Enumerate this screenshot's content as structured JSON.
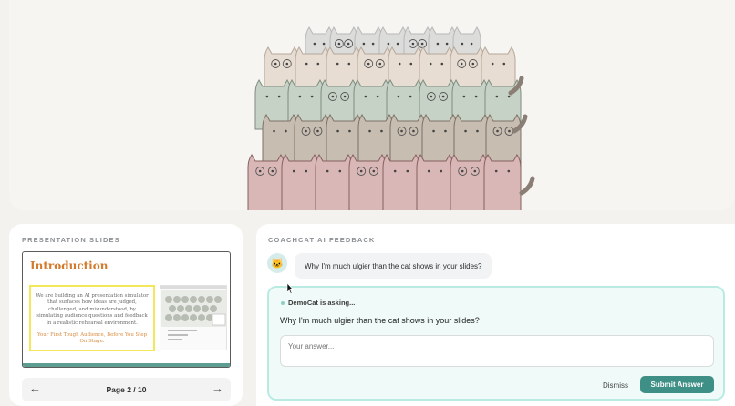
{
  "slides_panel": {
    "label": "PRESENTATION SLIDES",
    "slide": {
      "title": "Introduction",
      "body": "We are building an AI presentation simulator that surfaces how ideas are judged, challenged, and misunderstood, by simulating audience questions and feedback in a realistic rehearsal environment.",
      "tagline": "Your First Tough Audience, Before You Step On Stage."
    },
    "pager": {
      "prev": "←",
      "page_text": "Page 2 / 10",
      "next": "→"
    }
  },
  "feedback_panel": {
    "label": "COACHCAT AI FEEDBACK",
    "avatar_icon": "🐱",
    "user_message": "Why I'm much ulgier than the cat shows in your slides?",
    "ask_card": {
      "heading": "DemoCat is asking...",
      "question": "Why I'm much ulgier than the cat shows in your slides?",
      "answer_placeholder": "Your answer...",
      "dismiss_label": "Dismiss",
      "submit_label": "Submit Answer"
    }
  },
  "colors": {
    "accent": "#3e8f86",
    "card_border": "#b9ebe3",
    "slide_title": "#d37a2c",
    "highlight_box": "#f3e75a"
  }
}
